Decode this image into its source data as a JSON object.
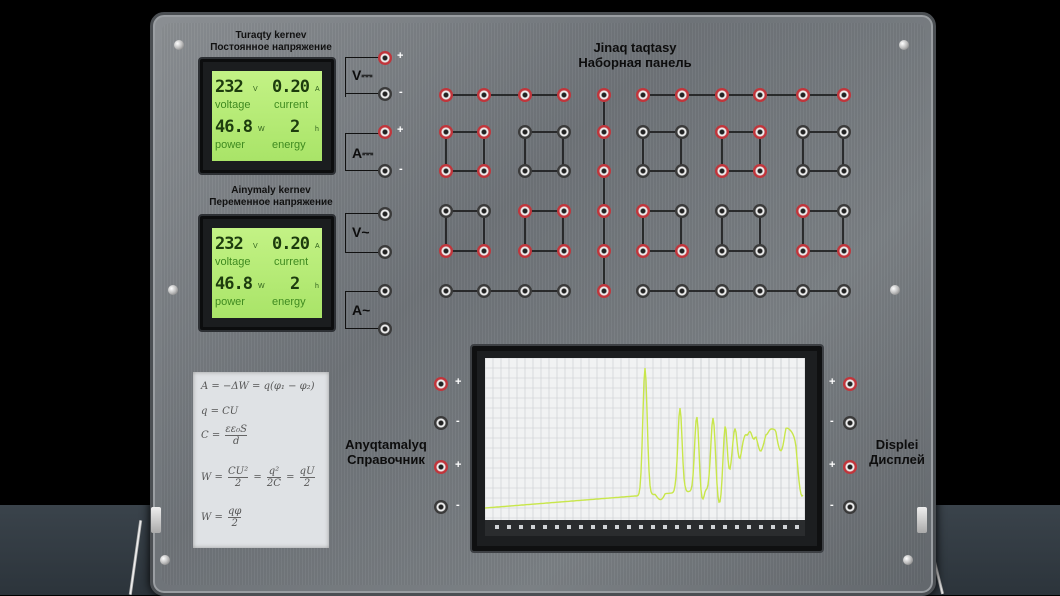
{
  "dc_source": {
    "title_1": "Turaqty kernev",
    "title_2": "Постоянное напряжение",
    "voltage_label": "V⎓",
    "current_label": "A⎓"
  },
  "ac_source": {
    "title_1": "Ainymaly kernev",
    "title_2": "Переменное напряжение",
    "voltage_label": "V~",
    "current_label": "A~"
  },
  "meter_dc": {
    "voltage": "232",
    "voltage_unit": "V",
    "current": "0.20",
    "current_unit": "A",
    "power": "46.8",
    "power_unit": "W",
    "energy": "2",
    "energy_unit": "h",
    "voltage_label": "voltage",
    "current_label": "current",
    "power_label": "power",
    "energy_label": "energy"
  },
  "meter_ac": {
    "voltage": "232",
    "voltage_unit": "V",
    "current": "0.20",
    "current_unit": "A",
    "power": "46.8",
    "power_unit": "W",
    "energy": "2",
    "energy_unit": "h",
    "voltage_label": "voltage",
    "current_label": "current",
    "power_label": "power",
    "energy_label": "energy"
  },
  "terminals": {
    "plus": "+",
    "minus": "-"
  },
  "breadboard": {
    "title_1": "Jinaq taqtasy",
    "title_2": "Наборная панель"
  },
  "reference": {
    "title_1": "Anyqtamalyq",
    "title_2": "Справочник"
  },
  "display": {
    "title_1": "Displei",
    "title_2": "Дисплей"
  },
  "formulas": {
    "f1": "A = −ΔW = q(φ₁ − φ₂)",
    "f2": "q = CU",
    "f3_lhs": "C =",
    "f3_num": "εε₀S",
    "f3_den": "d",
    "f4_lhs": "W =",
    "f4_n1": "CU²",
    "f4_d1": "2",
    "f4_eq1": "=",
    "f4_n2": "q²",
    "f4_d2": "2C",
    "f4_eq2": "=",
    "f4_n3": "qU",
    "f4_d3": "2",
    "f5_lhs": "W =",
    "f5_num": "qφ",
    "f5_den": "2"
  },
  "colors": {
    "lcd_bg": "#b5ea74",
    "jack_red": "#c0353b",
    "jack_black": "#3a3a3a",
    "trace": "#c8e64a"
  }
}
